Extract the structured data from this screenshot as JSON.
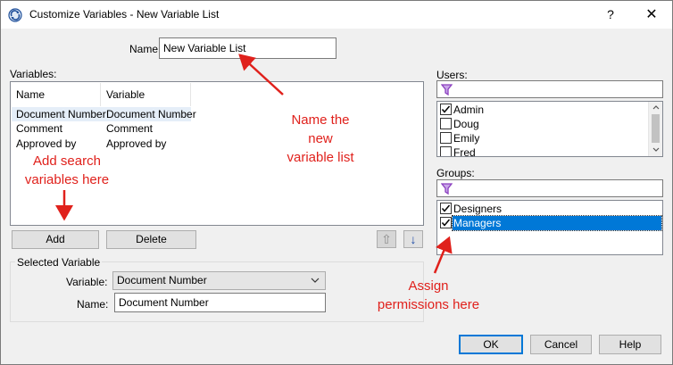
{
  "window": {
    "title": "Customize Variables - New Variable List",
    "help_glyph": "?",
    "close_glyph": "✕"
  },
  "name_field": {
    "label": "Name:",
    "value": "New Variable List"
  },
  "variables": {
    "label": "Variables:",
    "columns": [
      "Name",
      "Variable"
    ],
    "rows": [
      {
        "name": "Document Number",
        "variable": "Document Number"
      },
      {
        "name": "Comment",
        "variable": "Comment"
      },
      {
        "name": "Approved by",
        "variable": "Approved by"
      }
    ],
    "add_label": "Add",
    "delete_label": "Delete",
    "up_glyph": "⇧",
    "down_glyph": "↓"
  },
  "selected_variable": {
    "legend": "Selected Variable",
    "variable_label": "Variable:",
    "variable_value": "Document Number",
    "name_label": "Name:",
    "name_value": "Document Number"
  },
  "users": {
    "label": "Users:",
    "items": [
      {
        "label": "Admin",
        "checked": true
      },
      {
        "label": "Doug",
        "checked": false
      },
      {
        "label": "Emily",
        "checked": false
      },
      {
        "label": "Fred",
        "checked": false
      }
    ]
  },
  "groups": {
    "label": "Groups:",
    "items": [
      {
        "label": "Designers",
        "checked": true
      },
      {
        "label": "Managers",
        "checked": true,
        "selected": true
      }
    ]
  },
  "footer": {
    "ok_label": "OK",
    "cancel_label": "Cancel",
    "help_label": "Help"
  },
  "annotations": {
    "name_note": "Name the\nnew\nvariable list",
    "add_note": "Add search\nvariables here",
    "assign_note": "Assign\npermissions here"
  },
  "colors": {
    "annotation": "#e0211c",
    "selection": "#0078d7",
    "filter_icon": "#8b3fbf"
  }
}
